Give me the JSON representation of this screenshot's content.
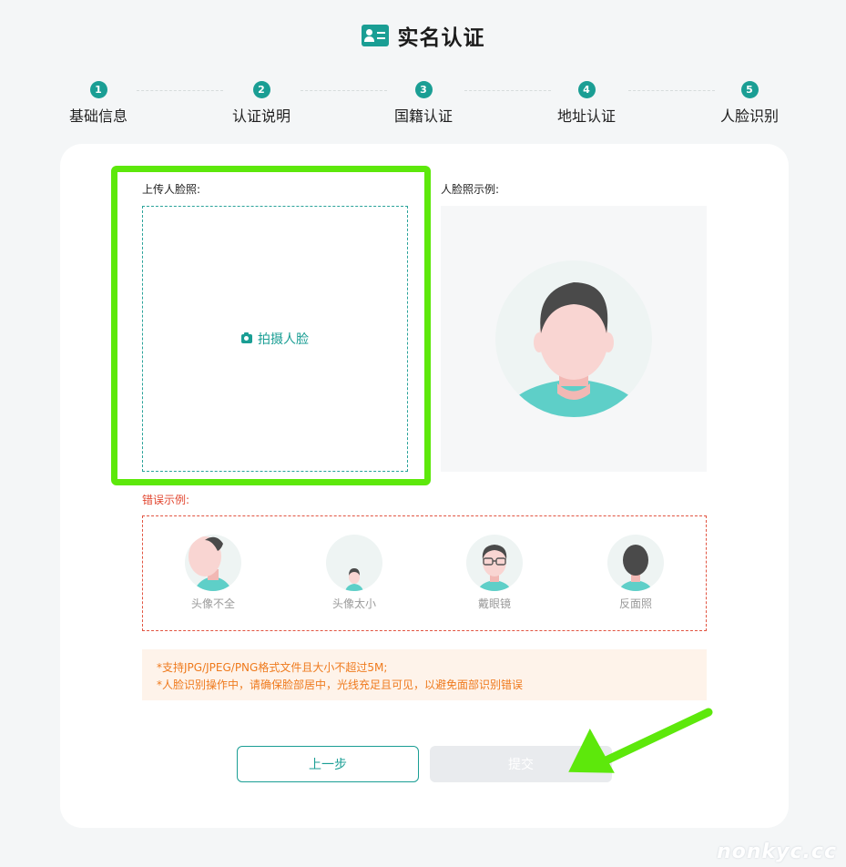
{
  "header": {
    "title": "实名认证",
    "icon": "id-card-icon"
  },
  "steps": [
    {
      "num": "1",
      "label": "基础信息"
    },
    {
      "num": "2",
      "label": "认证说明"
    },
    {
      "num": "3",
      "label": "国籍认证"
    },
    {
      "num": "4",
      "label": "地址认证"
    },
    {
      "num": "5",
      "label": "人脸识别"
    }
  ],
  "upload": {
    "label": "上传人脸照:",
    "button_label": "拍摄人脸",
    "icon": "camera-icon"
  },
  "sample": {
    "label": "人脸照示例:"
  },
  "errors": {
    "label": "错误示例:",
    "items": [
      {
        "caption": "头像不全"
      },
      {
        "caption": "头像太小"
      },
      {
        "caption": "戴眼镜"
      },
      {
        "caption": "反面照"
      }
    ]
  },
  "notice": {
    "line1": "*支持JPG/JPEG/PNG格式文件且大小不超过5M;",
    "line2": "*人脸识别操作中，请确保脸部居中，光线充足且可见，以避免面部识别错误"
  },
  "buttons": {
    "prev_label": "上一步",
    "submit_label": "提交"
  },
  "colors": {
    "accent": "#1a9e94",
    "error": "#e2462f",
    "notice_text": "#ef7a1d",
    "highlight": "#5de80b"
  },
  "watermark": "nonkyc.cc"
}
